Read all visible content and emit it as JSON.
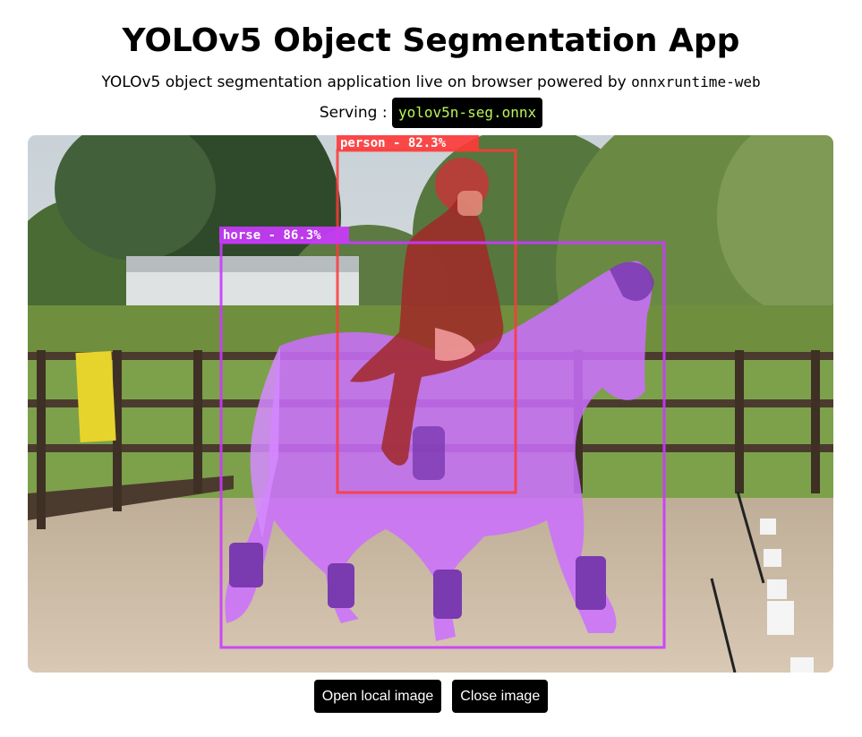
{
  "header": {
    "title": "YOLOv5 Object Segmentation App",
    "description_prefix": "YOLOv5 object segmentation application live on browser powered by",
    "description_code": "onnxruntime-web",
    "serving_label": "Serving :",
    "model_name": "yolov5n-seg.onnx"
  },
  "detections": [
    {
      "label": "person - 82.3%",
      "class": "person",
      "score": 82.3,
      "color": "#ff3838"
    },
    {
      "label": "horse - 86.3%",
      "class": "horse",
      "score": 86.3,
      "color": "#cb38ff"
    }
  ],
  "controls": {
    "open_label": "Open local image",
    "close_label": "Close image"
  },
  "colors": {
    "badge_text": "#b9f55a",
    "button_bg": "#000000",
    "button_text": "#ffffff"
  }
}
